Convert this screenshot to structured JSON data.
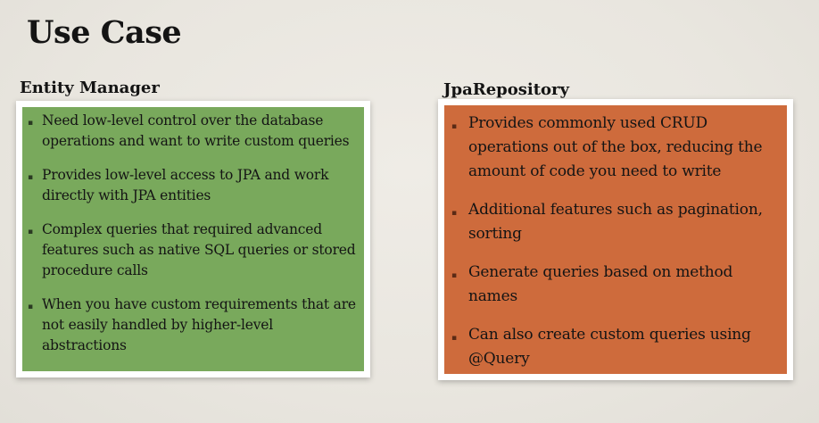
{
  "slide": {
    "title": "Use Case"
  },
  "entity_manager": {
    "heading": "Entity Manager",
    "color": "#79a95c",
    "bullet_symbol": "▪",
    "items": [
      {
        "text": "Need low-level control over the database operations and want to write custom queries"
      },
      {
        "text": "Provides low-level access to JPA and work directly with JPA entities"
      },
      {
        "text": "Complex queries that required advanced features such as native SQL queries or stored procedure calls"
      },
      {
        "text": "When you have custom requirements that are not easily handled by higher-level abstractions"
      }
    ]
  },
  "jpa_repository": {
    "heading": "JpaRepository",
    "color": "#ce6b3c",
    "bullet_symbol": "▪",
    "items": [
      {
        "text": "Provides commonly used CRUD operations out of the box, reducing the amount of code you need to write"
      },
      {
        "text": "Additional features such as pagination, sorting"
      },
      {
        "text": "Generate queries based on method names"
      },
      {
        "text": "Can also create custom queries using @Query"
      }
    ]
  }
}
